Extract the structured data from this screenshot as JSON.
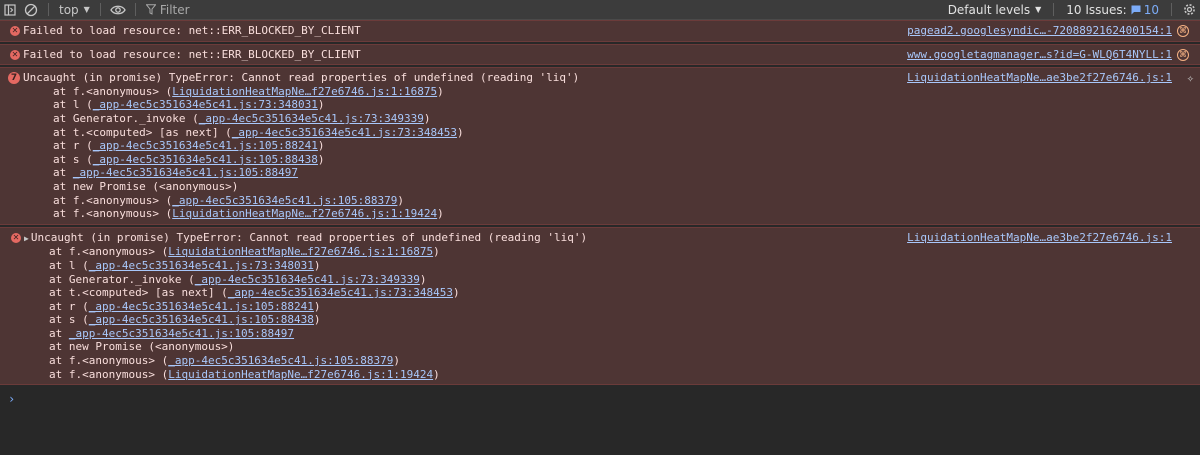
{
  "toolbar": {
    "context": "top",
    "filter_placeholder": "Filter",
    "levels": "Default levels",
    "issues_label": "10 Issues:",
    "issues_count": "10"
  },
  "messages": [
    {
      "text": "Failed to load resource: net::ERR_BLOCKED_BY_CLIENT",
      "source": "pagead2.googlesyndic…-7208892162400154:1"
    },
    {
      "text": "Failed to load resource: net::ERR_BLOCKED_BY_CLIENT",
      "source": "www.googletagmanager…s?id=G-WLQ6T4NYLL:1"
    }
  ],
  "error1": {
    "count": "7",
    "text": "Uncaught (in promise) TypeError: Cannot read properties of undefined (reading 'liq')",
    "source": "LiquidationHeatMapNe…ae3be2f27e6746.js:1",
    "stack": [
      {
        "pre": "at f.<anonymous> (",
        "link": "LiquidationHeatMapNe…f27e6746.js:1:16875",
        "post": ")"
      },
      {
        "pre": "at l (",
        "link": "_app-4ec5c351634e5c41.js:73:348031",
        "post": ")"
      },
      {
        "pre": "at Generator._invoke (",
        "link": "_app-4ec5c351634e5c41.js:73:349339",
        "post": ")"
      },
      {
        "pre": "at t.<computed> [as next] (",
        "link": "_app-4ec5c351634e5c41.js:73:348453",
        "post": ")"
      },
      {
        "pre": "at r (",
        "link": "_app-4ec5c351634e5c41.js:105:88241",
        "post": ")"
      },
      {
        "pre": "at s (",
        "link": "_app-4ec5c351634e5c41.js:105:88438",
        "post": ")"
      },
      {
        "pre": "at ",
        "link": "_app-4ec5c351634e5c41.js:105:88497",
        "post": ""
      },
      {
        "pre": "at new Promise (<anonymous>)",
        "link": "",
        "post": ""
      },
      {
        "pre": "at f.<anonymous> (",
        "link": "_app-4ec5c351634e5c41.js:105:88379",
        "post": ")"
      },
      {
        "pre": "at f.<anonymous> (",
        "link": "LiquidationHeatMapNe…f27e6746.js:1:19424",
        "post": ")"
      }
    ]
  },
  "error2": {
    "text": "Uncaught (in promise) TypeError: Cannot read properties of undefined (reading 'liq')",
    "source": "LiquidationHeatMapNe…ae3be2f27e6746.js:1",
    "stack": [
      {
        "pre": "at f.<anonymous> (",
        "link": "LiquidationHeatMapNe…f27e6746.js:1:16875",
        "post": ")"
      },
      {
        "pre": "at l (",
        "link": "_app-4ec5c351634e5c41.js:73:348031",
        "post": ")"
      },
      {
        "pre": "at Generator._invoke (",
        "link": "_app-4ec5c351634e5c41.js:73:349339",
        "post": ")"
      },
      {
        "pre": "at t.<computed> [as next] (",
        "link": "_app-4ec5c351634e5c41.js:73:348453",
        "post": ")"
      },
      {
        "pre": "at r (",
        "link": "_app-4ec5c351634e5c41.js:105:88241",
        "post": ")"
      },
      {
        "pre": "at s (",
        "link": "_app-4ec5c351634e5c41.js:105:88438",
        "post": ")"
      },
      {
        "pre": "at ",
        "link": "_app-4ec5c351634e5c41.js:105:88497",
        "post": ""
      },
      {
        "pre": "at new Promise (<anonymous>)",
        "link": "",
        "post": ""
      },
      {
        "pre": "at f.<anonymous> (",
        "link": "_app-4ec5c351634e5c41.js:105:88379",
        "post": ")"
      },
      {
        "pre": "at f.<anonymous> (",
        "link": "LiquidationHeatMapNe…f27e6746.js:1:19424",
        "post": ")"
      }
    ]
  },
  "prompt": "›"
}
